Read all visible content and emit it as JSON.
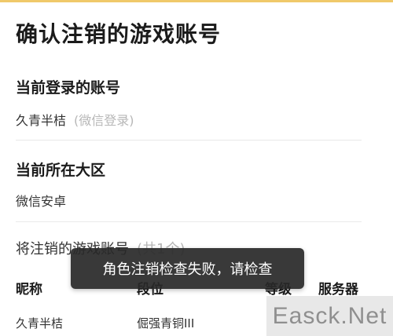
{
  "page": {
    "title": "确认注销的游戏账号"
  },
  "current_account": {
    "heading": "当前登录的账号",
    "name": "久青半桔",
    "login_method": "(微信登录)"
  },
  "current_region": {
    "heading": "当前所在大区",
    "value": "微信安卓"
  },
  "cancel_accounts": {
    "heading": "将注销的游戏账号",
    "count_note": "(共1个)",
    "columns": {
      "nickname": "昵称",
      "rank": "段位",
      "level": "等级",
      "server": "服务器"
    },
    "rows": [
      {
        "nickname": "久青半桔",
        "rank": "倔强青铜III"
      }
    ]
  },
  "toast": {
    "message": "角色注销检查失败，请检查"
  },
  "watermark": {
    "text": "Easck.Net"
  }
}
